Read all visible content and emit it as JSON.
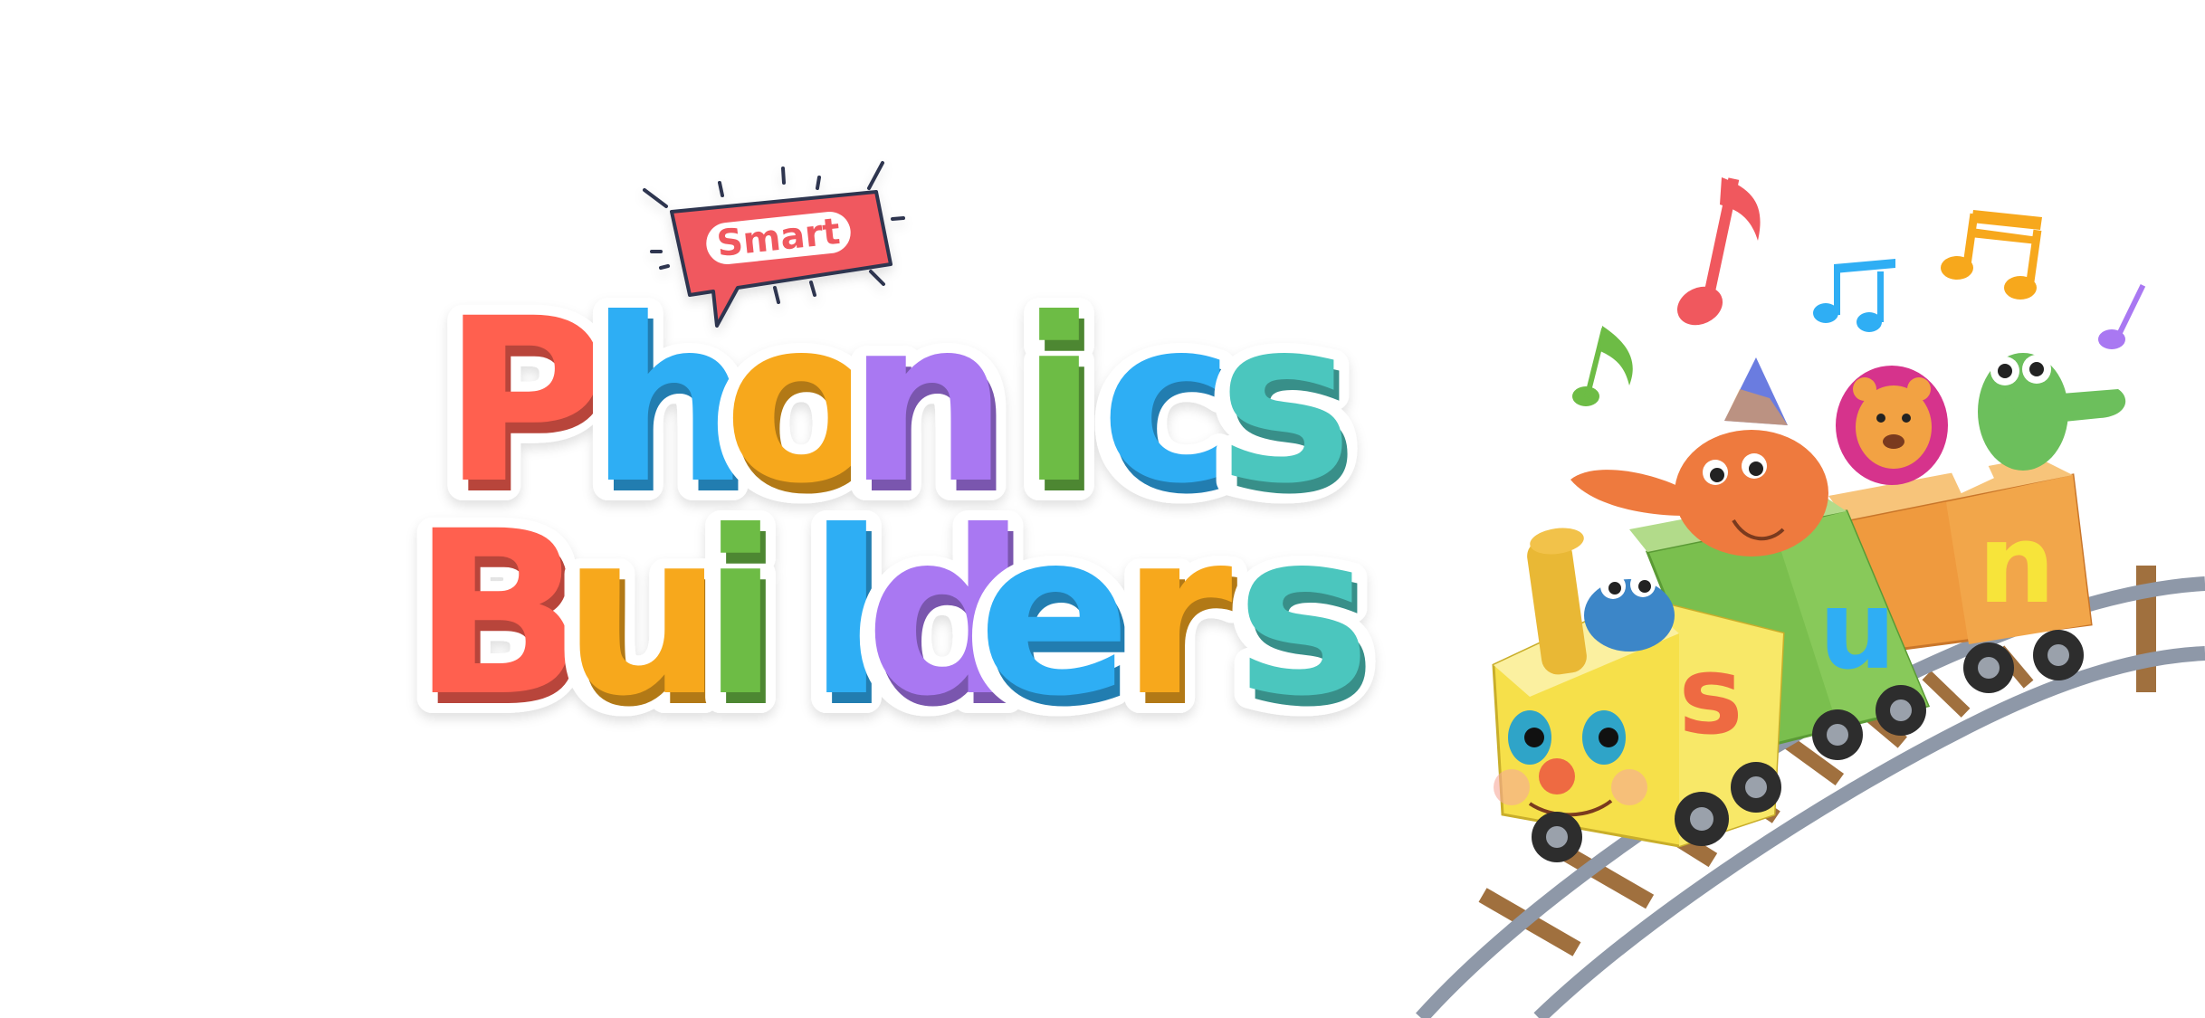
{
  "logo": {
    "badge_text": "Smart",
    "line1": "Phonics",
    "line2": "Builders",
    "line1_colors": [
      "#FF6050",
      "#2FAEF4",
      "#F7A81C",
      "#A978F2",
      "#6DBC45",
      "#2FAEF4",
      "#4CC6BE"
    ],
    "line2_colors": [
      "#FF6050",
      "#F7A81C",
      "#6DBC45",
      "#2FAEF4",
      "#A978F2",
      "#2FAEF4",
      "#F7A81C",
      "#4CC6BE"
    ],
    "badge_color": "#F0585E"
  },
  "train": {
    "car_letters": [
      "s",
      "u",
      "n"
    ],
    "letter_colors": [
      "#EE6A42",
      "#2FAEF4",
      "#F7E43A"
    ],
    "car_colors": [
      "#F6E04A",
      "#7ABF4E",
      "#EF9A3E"
    ],
    "note_colors": [
      "#F0585E",
      "#2FAEF4",
      "#F7A81C",
      "#6DBC45",
      "#A978F2"
    ],
    "characters": [
      "engine-face",
      "frog",
      "elephant",
      "lion",
      "crocodile"
    ]
  }
}
